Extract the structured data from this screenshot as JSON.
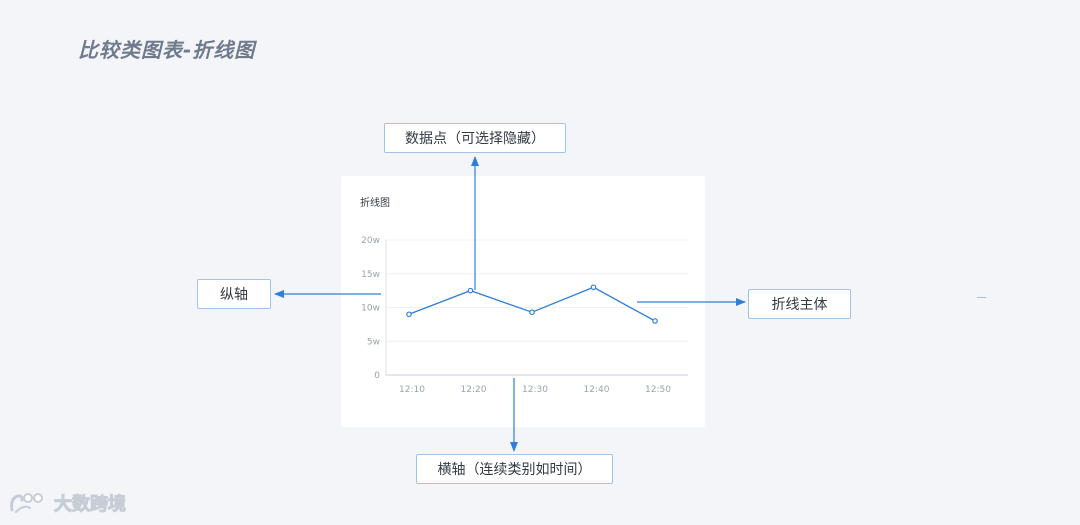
{
  "page": {
    "title": "比较类图表-折线图"
  },
  "card": {
    "title": "折线图"
  },
  "callouts": {
    "data_point": "数据点（可选择隐藏）",
    "y_axis": "纵轴",
    "line_body": "折线主体",
    "x_axis": "横轴（连续类别如时间）"
  },
  "watermark": {
    "text": "大数跨境"
  },
  "colors": {
    "background": "#f3f5f9",
    "accent": "#2f7fd8",
    "callout_border": "#9fc3ea",
    "grid": "#eef0f3",
    "axis_text": "#9aa3ae"
  },
  "chart_data": {
    "type": "line",
    "title": "折线图",
    "categories": [
      "12:10",
      "12:20",
      "12:30",
      "12:40",
      "12:50"
    ],
    "values": [
      9,
      12.5,
      9.3,
      13,
      8
    ],
    "y_ticks": [
      "0",
      "5w",
      "10w",
      "15w",
      "20w"
    ],
    "ylim": [
      0,
      20
    ],
    "y_unit": "w",
    "grid": true,
    "show_points": true
  }
}
